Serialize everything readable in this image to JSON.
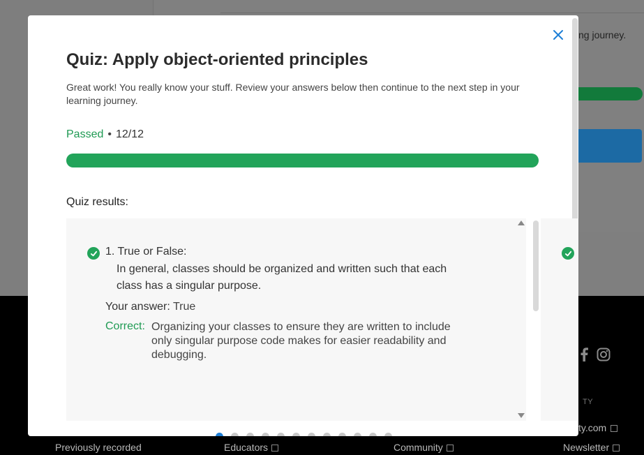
{
  "background": {
    "journey_text": "ng journey.",
    "footer_links": [
      {
        "label": "Previously recorded"
      },
      {
        "label": "Educators"
      },
      {
        "label": "Community"
      },
      {
        "label": "Newsletter"
      }
    ],
    "footer_section": "TY",
    "footer_url": "ty.com"
  },
  "modal": {
    "title": "Quiz: Apply object-oriented principles",
    "subtitle": "Great work! You really know your stuff. Review your answers below then continue to the next step in your learning journey.",
    "status": "Passed",
    "separator": "•",
    "score": "12/12",
    "progress": 1.0,
    "results_label": "Quiz results:",
    "question": {
      "title": "1. True or False:",
      "body": "In general, classes should be organized and written such that each class has a singular purpose.",
      "answer_label": "Your answer:",
      "answer_value": "True",
      "correct_label": "Correct:",
      "correct_text": "Organizing your classes to ensure they are written to include only singular purpose code makes for easier readability and debugging."
    },
    "pagination": {
      "total": 12,
      "active": 0
    }
  },
  "colors": {
    "accent_green": "#22a45a",
    "accent_blue": "#1e7fd6",
    "close_blue": "#1e7fd6"
  }
}
